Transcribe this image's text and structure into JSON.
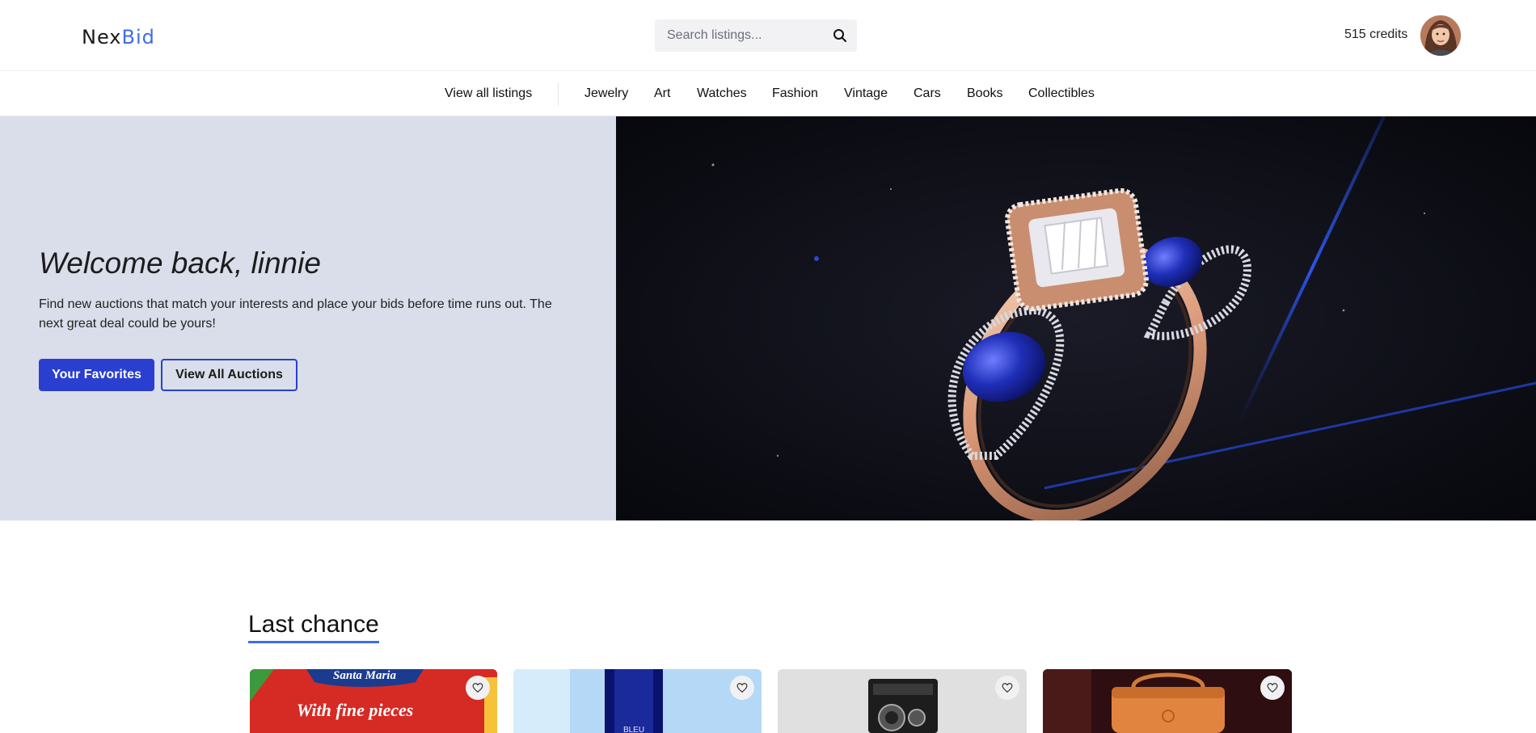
{
  "brand": {
    "logo_part1": "Nex",
    "logo_part2": "Bid",
    "logo_color_main": "#1a1a1a",
    "logo_color_accent": "#3d6de8"
  },
  "header": {
    "search_placeholder": "Search listings...",
    "credits": "515 credits"
  },
  "nav": {
    "view_all": "View all listings",
    "categories": [
      "Jewelry",
      "Art",
      "Watches",
      "Fashion",
      "Vintage",
      "Cars",
      "Books",
      "Collectibles"
    ]
  },
  "hero": {
    "title": "Welcome back, linnie",
    "text": "Find new auctions that match your interests and place your bids before time runs out. The next great deal could be yours!",
    "primary_button": "Your Favorites",
    "secondary_button": "View All Auctions",
    "image_subject": "ring-with-blue-sapphires"
  },
  "sections": {
    "last_chance": {
      "title": "Last chance",
      "cards": [
        {
          "subject": "santa-maria-tacos-package",
          "image_text_1": "Santa Maria",
          "image_text_2": "With fine pieces"
        },
        {
          "subject": "bleu-perfume-bottle",
          "image_text_1": "BLEU"
        },
        {
          "subject": "vintage-camera"
        },
        {
          "subject": "orange-handbag"
        }
      ]
    }
  },
  "colors": {
    "primary": "#2a3fd0",
    "accent": "#3d6de8",
    "hero_bg": "#d9deea"
  }
}
